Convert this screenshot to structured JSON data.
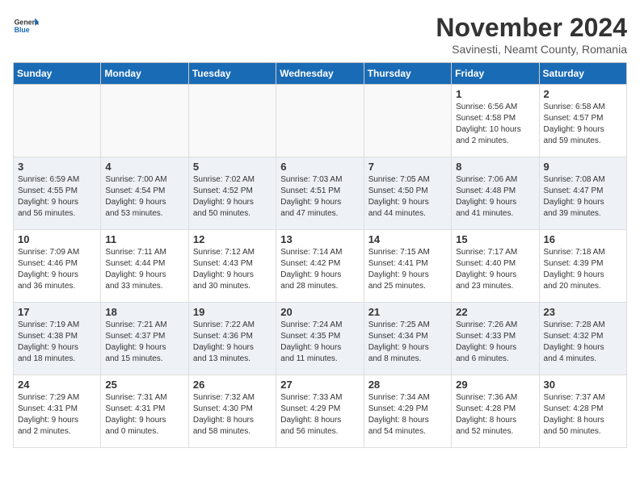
{
  "header": {
    "logo_line1": "General",
    "logo_line2": "Blue",
    "month": "November 2024",
    "location": "Savinesti, Neamt County, Romania"
  },
  "weekdays": [
    "Sunday",
    "Monday",
    "Tuesday",
    "Wednesday",
    "Thursday",
    "Friday",
    "Saturday"
  ],
  "weeks": [
    [
      {
        "day": "",
        "info": ""
      },
      {
        "day": "",
        "info": ""
      },
      {
        "day": "",
        "info": ""
      },
      {
        "day": "",
        "info": ""
      },
      {
        "day": "",
        "info": ""
      },
      {
        "day": "1",
        "info": "Sunrise: 6:56 AM\nSunset: 4:58 PM\nDaylight: 10 hours\nand 2 minutes."
      },
      {
        "day": "2",
        "info": "Sunrise: 6:58 AM\nSunset: 4:57 PM\nDaylight: 9 hours\nand 59 minutes."
      }
    ],
    [
      {
        "day": "3",
        "info": "Sunrise: 6:59 AM\nSunset: 4:55 PM\nDaylight: 9 hours\nand 56 minutes."
      },
      {
        "day": "4",
        "info": "Sunrise: 7:00 AM\nSunset: 4:54 PM\nDaylight: 9 hours\nand 53 minutes."
      },
      {
        "day": "5",
        "info": "Sunrise: 7:02 AM\nSunset: 4:52 PM\nDaylight: 9 hours\nand 50 minutes."
      },
      {
        "day": "6",
        "info": "Sunrise: 7:03 AM\nSunset: 4:51 PM\nDaylight: 9 hours\nand 47 minutes."
      },
      {
        "day": "7",
        "info": "Sunrise: 7:05 AM\nSunset: 4:50 PM\nDaylight: 9 hours\nand 44 minutes."
      },
      {
        "day": "8",
        "info": "Sunrise: 7:06 AM\nSunset: 4:48 PM\nDaylight: 9 hours\nand 41 minutes."
      },
      {
        "day": "9",
        "info": "Sunrise: 7:08 AM\nSunset: 4:47 PM\nDaylight: 9 hours\nand 39 minutes."
      }
    ],
    [
      {
        "day": "10",
        "info": "Sunrise: 7:09 AM\nSunset: 4:46 PM\nDaylight: 9 hours\nand 36 minutes."
      },
      {
        "day": "11",
        "info": "Sunrise: 7:11 AM\nSunset: 4:44 PM\nDaylight: 9 hours\nand 33 minutes."
      },
      {
        "day": "12",
        "info": "Sunrise: 7:12 AM\nSunset: 4:43 PM\nDaylight: 9 hours\nand 30 minutes."
      },
      {
        "day": "13",
        "info": "Sunrise: 7:14 AM\nSunset: 4:42 PM\nDaylight: 9 hours\nand 28 minutes."
      },
      {
        "day": "14",
        "info": "Sunrise: 7:15 AM\nSunset: 4:41 PM\nDaylight: 9 hours\nand 25 minutes."
      },
      {
        "day": "15",
        "info": "Sunrise: 7:17 AM\nSunset: 4:40 PM\nDaylight: 9 hours\nand 23 minutes."
      },
      {
        "day": "16",
        "info": "Sunrise: 7:18 AM\nSunset: 4:39 PM\nDaylight: 9 hours\nand 20 minutes."
      }
    ],
    [
      {
        "day": "17",
        "info": "Sunrise: 7:19 AM\nSunset: 4:38 PM\nDaylight: 9 hours\nand 18 minutes."
      },
      {
        "day": "18",
        "info": "Sunrise: 7:21 AM\nSunset: 4:37 PM\nDaylight: 9 hours\nand 15 minutes."
      },
      {
        "day": "19",
        "info": "Sunrise: 7:22 AM\nSunset: 4:36 PM\nDaylight: 9 hours\nand 13 minutes."
      },
      {
        "day": "20",
        "info": "Sunrise: 7:24 AM\nSunset: 4:35 PM\nDaylight: 9 hours\nand 11 minutes."
      },
      {
        "day": "21",
        "info": "Sunrise: 7:25 AM\nSunset: 4:34 PM\nDaylight: 9 hours\nand 8 minutes."
      },
      {
        "day": "22",
        "info": "Sunrise: 7:26 AM\nSunset: 4:33 PM\nDaylight: 9 hours\nand 6 minutes."
      },
      {
        "day": "23",
        "info": "Sunrise: 7:28 AM\nSunset: 4:32 PM\nDaylight: 9 hours\nand 4 minutes."
      }
    ],
    [
      {
        "day": "24",
        "info": "Sunrise: 7:29 AM\nSunset: 4:31 PM\nDaylight: 9 hours\nand 2 minutes."
      },
      {
        "day": "25",
        "info": "Sunrise: 7:31 AM\nSunset: 4:31 PM\nDaylight: 9 hours\nand 0 minutes."
      },
      {
        "day": "26",
        "info": "Sunrise: 7:32 AM\nSunset: 4:30 PM\nDaylight: 8 hours\nand 58 minutes."
      },
      {
        "day": "27",
        "info": "Sunrise: 7:33 AM\nSunset: 4:29 PM\nDaylight: 8 hours\nand 56 minutes."
      },
      {
        "day": "28",
        "info": "Sunrise: 7:34 AM\nSunset: 4:29 PM\nDaylight: 8 hours\nand 54 minutes."
      },
      {
        "day": "29",
        "info": "Sunrise: 7:36 AM\nSunset: 4:28 PM\nDaylight: 8 hours\nand 52 minutes."
      },
      {
        "day": "30",
        "info": "Sunrise: 7:37 AM\nSunset: 4:28 PM\nDaylight: 8 hours\nand 50 minutes."
      }
    ]
  ]
}
